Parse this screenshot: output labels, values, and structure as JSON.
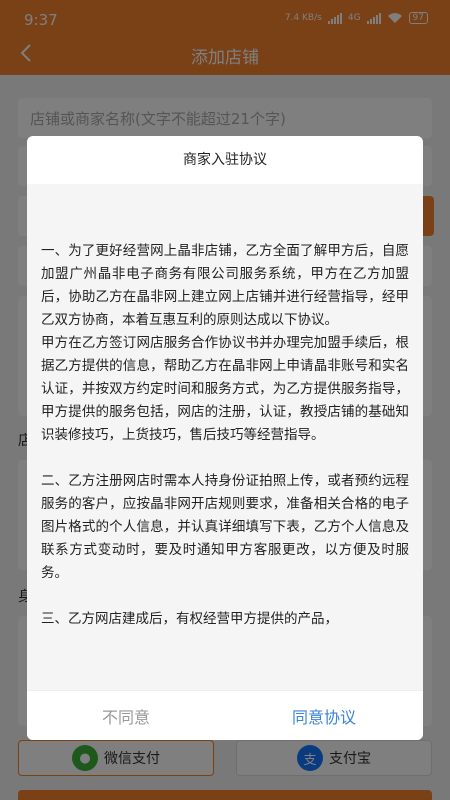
{
  "status": {
    "time": "9:37",
    "net": "4G",
    "speed": "7.4 KB/s",
    "battery": "97"
  },
  "header": {
    "title": "添加店铺"
  },
  "form": {
    "name_placeholder": "店铺或商家名称(文字不能超过21个字)",
    "side_label_1": "店",
    "side_label_2": "身"
  },
  "payment": {
    "wechat": "微信支付",
    "alipay": "支付宝",
    "alipay_icon": "支"
  },
  "dialog": {
    "title": "商家入驻协议",
    "paragraphs": [
      "一、为了更好经营网上晶非店铺，乙方全面了解甲方后，自愿加盟广州晶非电子商务有限公司服务系统，甲方在乙方加盟后，协助乙方在晶非网上建立网上店铺并进行经营指导，经甲乙双方协商，本着互惠互利的原则达成以下协议。",
      "甲方在乙方签订网店服务合作协议书并办理完加盟手续后，根据乙方提供的信息，帮助乙方在晶非网上申请晶非账号和实名认证，并按双方约定时间和服务方式，为乙方提供服务指导，甲方提供的服务包括，网店的注册，认证，教授店铺的基础知识装修技巧，上货技巧，售后技巧等经营指导。",
      "二、乙方注册网店时需本人持身份证拍照上传，或者预约远程服务的客户，应按晶非网开店规则要求，准备相关合格的电子图片格式的个人信息，并认真详细填写下表，乙方个人信息及联系方式变动时，要及时通知甲方客服更改，以方便及时服务。",
      "三、乙方网店建成后，有权经营甲方提供的产品，"
    ],
    "disagree": "不同意",
    "agree": "同意协议"
  },
  "colors": {
    "accent": "#f5812d",
    "agree": "#3b83d6"
  }
}
